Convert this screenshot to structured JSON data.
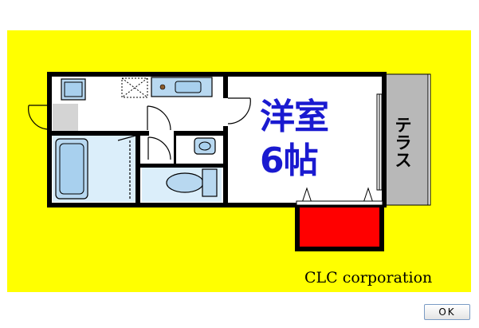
{
  "floor_plan": {
    "room_name": "洋室",
    "room_size": "6帖",
    "terrace_label": [
      "テ",
      "ラ",
      "ス"
    ],
    "company": "CLC corporation"
  },
  "dialog": {
    "ok_label": "OK"
  },
  "colors": {
    "background": "#ffff00",
    "walls": "#000000",
    "fixtures": "#b8d8f0",
    "room_text": "#1a1ad0",
    "storage": "#ff0000",
    "terrace": "#b8b8b8"
  }
}
